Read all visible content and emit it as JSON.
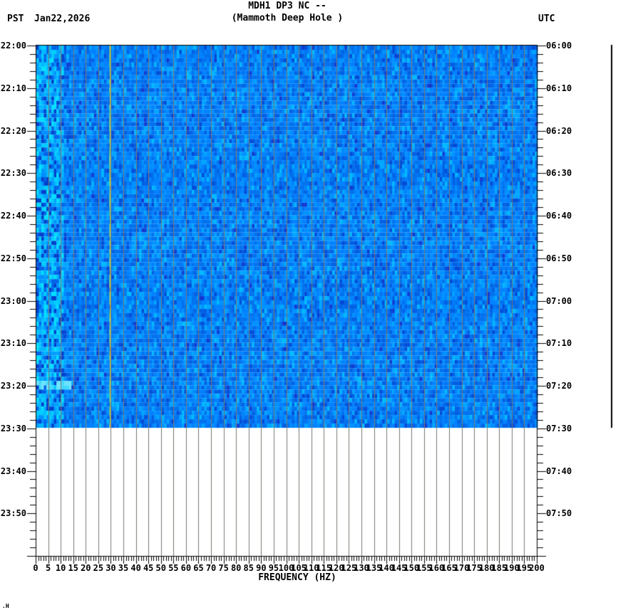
{
  "header": {
    "timezone_left": "PST",
    "date": "Jan22,2026",
    "timezone_right": "UTC"
  },
  "footer_mark": ".H",
  "chart_data": {
    "type": "heatmap",
    "subtype": "seismic-spectrogram",
    "title": "MDH1 DP3 NC --",
    "subtitle": "(Mammoth Deep Hole )",
    "xlabel": "FREQUENCY (HZ)",
    "x_range_hz": [
      0,
      200
    ],
    "x_major_tick_hz": 5,
    "x_minor_tick_hz": 1,
    "x_tick_labels": [
      "0",
      "5",
      "10",
      "15",
      "20",
      "25",
      "30",
      "35",
      "40",
      "45",
      "50",
      "55",
      "60",
      "65",
      "70",
      "75",
      "80",
      "85",
      "90",
      "95",
      "100",
      "105",
      "110",
      "115",
      "120",
      "125",
      "130",
      "135",
      "140",
      "145",
      "150",
      "155",
      "160",
      "165",
      "170",
      "175",
      "180",
      "185",
      "190",
      "195",
      "200"
    ],
    "grid": "vertical-lines-every-5hz",
    "left_axis": {
      "timezone": "PST",
      "date": "Jan22,2026",
      "start": "22:00",
      "end": "24:00",
      "major_tick_minutes": 10,
      "minor_tick_minutes": 2,
      "tick_labels": [
        "22:00",
        "22:10",
        "22:20",
        "22:30",
        "22:40",
        "22:50",
        "23:00",
        "23:10",
        "23:20",
        "23:30",
        "23:40",
        "23:50"
      ]
    },
    "right_axis": {
      "timezone": "UTC",
      "start": "06:00",
      "end": "08:00",
      "major_tick_minutes": 10,
      "minor_tick_minutes": 2,
      "tick_labels": [
        "06:00",
        "06:10",
        "06:20",
        "06:30",
        "06:40",
        "06:50",
        "07:00",
        "07:10",
        "07:20",
        "07:30",
        "07:40",
        "07:50"
      ]
    },
    "data_time_span": {
      "start_pst": "22:00",
      "end_pst": "23:30",
      "minutes_with_data": 90,
      "empty_below": "23:30 to 24:00 PST is blank (no data yet)"
    },
    "spectrogram": {
      "grid_color": "#7a7a70",
      "scale_bar_right": true,
      "background_palette": [
        [
          "#0072ee",
          0.26
        ],
        [
          "#0082ff",
          0.24
        ],
        [
          "#0092ff",
          0.16
        ],
        [
          "#0060e4",
          0.14
        ],
        [
          "#00a6ff",
          0.1
        ],
        [
          "#004cd8",
          0.05
        ],
        [
          "#00baff",
          0.04
        ],
        [
          "#1238d0",
          0.01
        ]
      ],
      "low_freq_palette": [
        [
          "#00b8ff",
          0.2
        ],
        [
          "#00ccff",
          0.14
        ],
        [
          "#0090ff",
          0.16
        ],
        [
          "#0064e8",
          0.16
        ],
        [
          "#00e0ff",
          0.08
        ],
        [
          "#0040cc",
          0.12
        ],
        [
          "#00a0ff",
          0.14
        ]
      ],
      "features": [
        {
          "kind": "tonal-line",
          "frequency_hz": 29.3,
          "colors": [
            [
              "#dce83c",
              0.7
            ],
            [
              "#e8a830",
              0.12
            ],
            [
              "#8cd45c",
              0.1
            ],
            [
              "#c0e040",
              0.08
            ]
          ],
          "description": "persistent narrow yellow-green spectral line near 29-30 Hz for whole record"
        },
        {
          "kind": "broadband-burst",
          "time_pst": "23:20",
          "max_frequency_hz": 14,
          "color": "#40d8ff",
          "description": "brief bright low-frequency band near 23:20 PST"
        }
      ]
    }
  }
}
